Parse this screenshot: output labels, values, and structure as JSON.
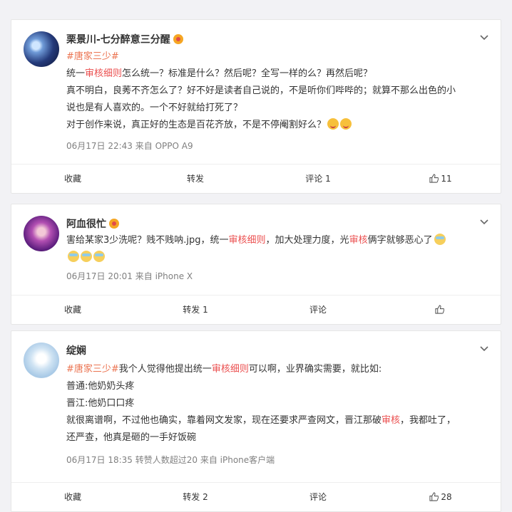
{
  "posts": [
    {
      "username": "栗景川-七分醉意三分醒",
      "paragraphs": [
        [
          {
            "t": "tag",
            "v": "#唐家三少#"
          }
        ],
        [
          {
            "t": "text",
            "v": "统一"
          },
          {
            "t": "kw",
            "v": "审核细则"
          },
          {
            "t": "text",
            "v": "怎么统一？标准是什么？然后呢？全写一样的么？再然后呢？"
          }
        ],
        [
          {
            "t": "text",
            "v": "真不明白，良莠不齐怎么了？好不好是读者自己说的，不是听你们哔哔的；就算不那么出色的小"
          }
        ],
        [
          {
            "t": "text",
            "v": "说也是有人喜欢的。一个不好就给打死了？"
          }
        ],
        [
          {
            "t": "text",
            "v": "对于创作来说，真正好的生态是百花齐放，不是不停阉割好么？"
          },
          {
            "t": "emoji",
            "v": "smile"
          },
          {
            "t": "emoji",
            "v": "smile"
          }
        ]
      ],
      "meta": "06月17日 22:43  来自 OPPO A9",
      "actions": {
        "favorite": "收藏",
        "repost": "转发",
        "comment": "评论 1",
        "like": "11"
      }
    },
    {
      "username": "阿血很忙",
      "paragraphs": [
        [
          {
            "t": "text",
            "v": "害给某家3少洗呢？贱不贱呐.jpg，统一"
          },
          {
            "t": "kw",
            "v": "审核细则"
          },
          {
            "t": "text",
            "v": "，加大处理力度，光"
          },
          {
            "t": "kw",
            "v": "审核"
          },
          {
            "t": "text",
            "v": "俩字就够恶心了"
          },
          {
            "t": "emoji",
            "v": "cool"
          }
        ],
        [
          {
            "t": "emoji",
            "v": "cool"
          },
          {
            "t": "emoji",
            "v": "cool"
          },
          {
            "t": "emoji",
            "v": "cool"
          }
        ]
      ],
      "meta": "06月17日 20:01  来自 iPhone X",
      "actions": {
        "favorite": "收藏",
        "repost": "转发 1",
        "comment": "评论",
        "like": ""
      }
    },
    {
      "username": "绽娴",
      "paragraphs": [
        [
          {
            "t": "tag",
            "v": "#唐家三少#"
          },
          {
            "t": "text",
            "v": "我个人觉得他提出统一"
          },
          {
            "t": "kw",
            "v": "审核细则"
          },
          {
            "t": "text",
            "v": "可以啊，业界确实需要，就比如:"
          }
        ],
        [
          {
            "t": "text",
            "v": "普通:他奶奶头疼"
          }
        ],
        [
          {
            "t": "text",
            "v": "晋江:他奶口口疼"
          }
        ],
        [
          {
            "t": "text",
            "v": "就很离谱啊，不过他也确实，靠着网文发家，现在还要求严查网文，晋江那破"
          },
          {
            "t": "kw",
            "v": "审核"
          },
          {
            "t": "text",
            "v": "，我都吐了，"
          }
        ],
        [
          {
            "t": "text",
            "v": "还严查，他真是砸的一手好饭碗"
          }
        ]
      ],
      "meta": "06月17日 18:35 转赞人数超过20  来自 iPhone客户端",
      "actions": {
        "favorite": "收藏",
        "repost": "转发 2",
        "comment": "评论",
        "like": "28"
      }
    }
  ]
}
